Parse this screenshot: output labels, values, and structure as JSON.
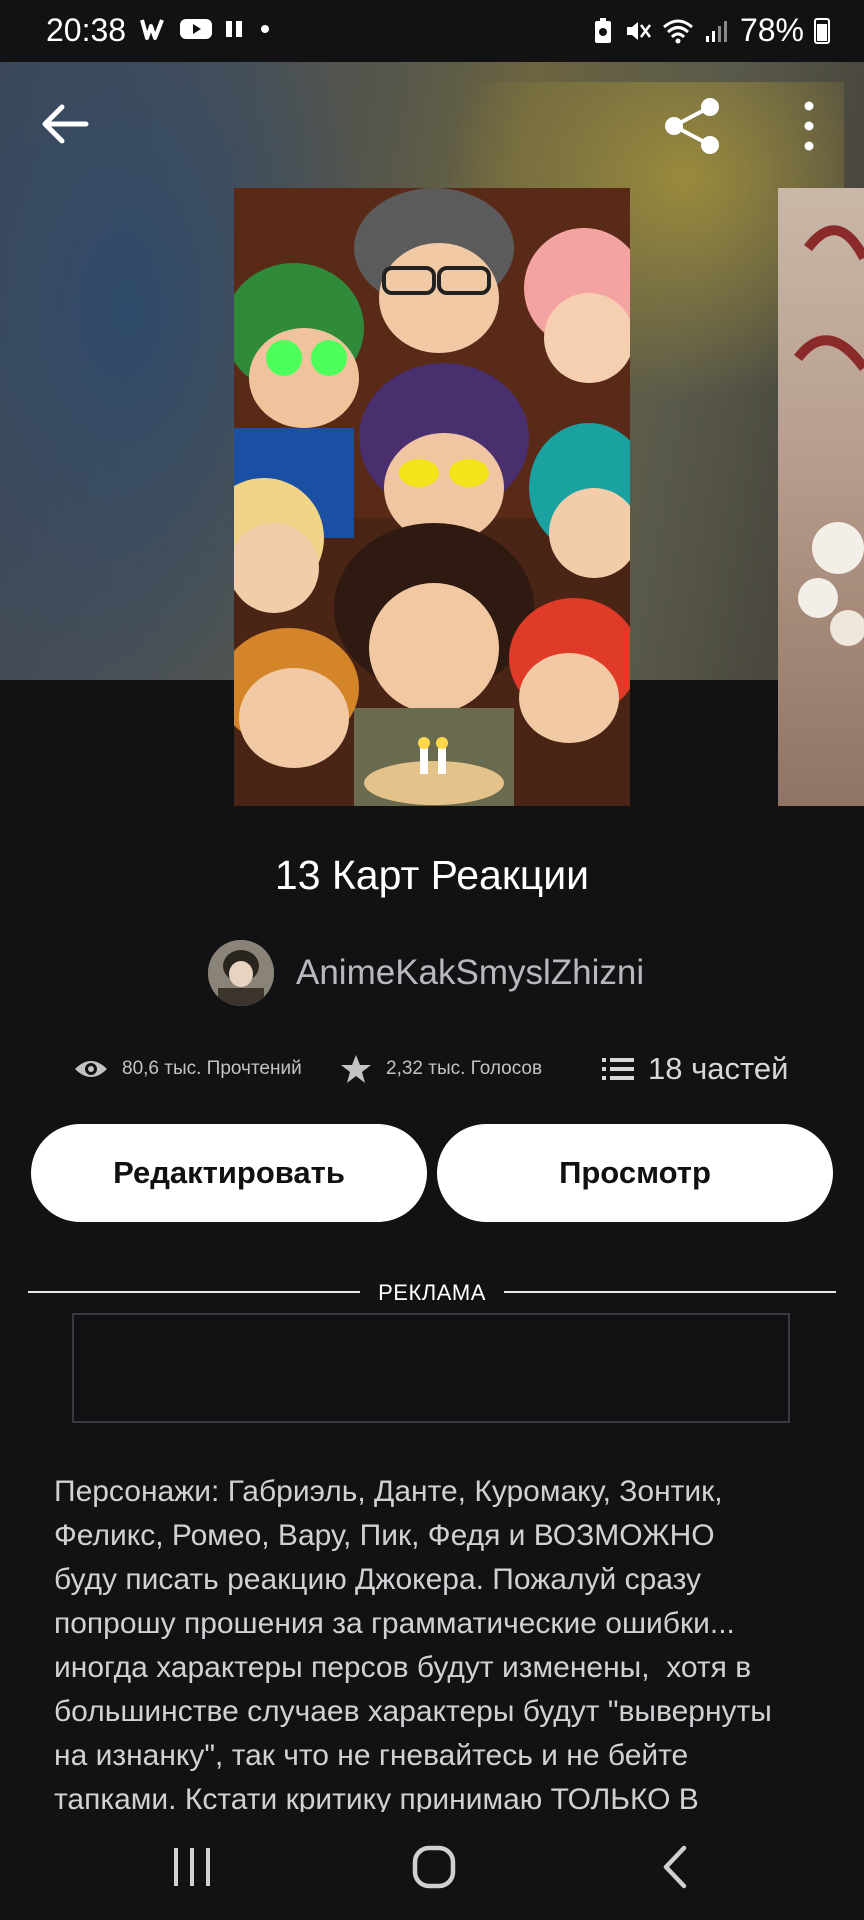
{
  "status_bar": {
    "time": "20:38",
    "battery": "78%",
    "left_icons": [
      "wattpad-icon",
      "youtube-icon",
      "pause-icon",
      "dot-icon"
    ],
    "right_icons": [
      "battery-saver-icon",
      "mute-icon",
      "wifi-icon",
      "signal-icon",
      "battery-icon"
    ]
  },
  "header": {
    "back_icon": "arrow-left-icon",
    "share_icon": "share-icon",
    "more_icon": "more-vertical-icon"
  },
  "story": {
    "title": "13 Карт Реакции",
    "author": "AnimeKakSmyslZhizni"
  },
  "stats": {
    "reads": "80,6 тыс. Прочтений",
    "votes": "2,32 тыс. Голосов",
    "parts": "18 частей"
  },
  "actions": {
    "edit_label": "Редактировать",
    "view_label": "Просмотр"
  },
  "ad": {
    "label": "РЕКЛАМА"
  },
  "description": "Персонажи: Габриэль, Данте, Куромаку, Зонтик,\nФеликс, Ромео, Вару, Пик, Федя и ВОЗМОЖНО\nбуду писать реакцию Джокера. Пожалуй сразу\nпопрошу прошения за грамматические ошибки...\nиногда характеры персов будут изменены,  хотя в\nбольшинстве случаев характеры будут \"вывернуты\nна изнанку\", так что не гневайтесь и не бейте\nтапками. Кстати критику принимаю ТОЛЬКО В",
  "nav": {
    "recent_icon": "recent-apps-icon",
    "home_icon": "home-icon",
    "back_icon": "back-chevron-icon"
  },
  "colors": {
    "background": "#121113",
    "button_bg": "#ffffff",
    "text_secondary": "#b9b9bd"
  }
}
